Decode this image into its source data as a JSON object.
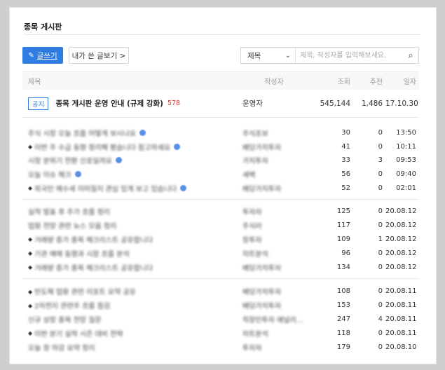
{
  "board": {
    "title": "종목 게시판"
  },
  "toolbar": {
    "write_label": "글쓰기",
    "my_posts_label": "내가 쓴 글보기 >",
    "search_type": "제목",
    "search_placeholder": "제목, 작성자를 입력해보세요."
  },
  "table": {
    "headers": {
      "title": "제목",
      "author": "작성자",
      "views": "조회",
      "likes": "추천",
      "date": "일자"
    },
    "notice": {
      "badge": "공지",
      "title": "종목 게시판 운영 안내 (규제 강화)",
      "comment_count": "578",
      "author": "운영자",
      "views": "545,144",
      "likes": "1,486",
      "date": "17.10.30"
    },
    "groups": [
      [
        {
          "title": "주식 시장 오늘 흐름 어떻게 보시나요",
          "bullet": false,
          "new": true,
          "author": "주식초보",
          "views": "30",
          "likes": "0",
          "date": "13:50"
        },
        {
          "title": "이번 주 수급 동향 정리해 봤습니다 참고하세요",
          "bullet": true,
          "new": true,
          "author": "배당가치투자",
          "views": "41",
          "likes": "0",
          "date": "10:11"
        },
        {
          "title": "시장 분위기 전환 신호일까요",
          "bullet": false,
          "new": true,
          "author": "가치투자",
          "views": "33",
          "likes": "3",
          "date": "09:53"
        },
        {
          "title": "오늘 이슈 체크",
          "bullet": false,
          "new": true,
          "author": "새벽",
          "views": "56",
          "likes": "0",
          "date": "09:40"
        },
        {
          "title": "외국인 매수세 이어질지 관심 있게 보고 있습니다",
          "bullet": true,
          "new": true,
          "author": "배당가치투자",
          "views": "52",
          "likes": "0",
          "date": "02:01"
        }
      ],
      [
        {
          "title": "실적 발표 후 주가 흐름 정리",
          "bullet": false,
          "new": false,
          "author": "투자자",
          "views": "125",
          "likes": "0",
          "date": "20.08.12"
        },
        {
          "title": "업황 전망 관련 뉴스 모음 정리",
          "bullet": false,
          "new": false,
          "author": "주식러",
          "views": "117",
          "likes": "0",
          "date": "20.08.12"
        },
        {
          "title": "거래량 증가 종목 체크리스트 공유합니다",
          "bullet": true,
          "new": false,
          "author": "장투자",
          "views": "109",
          "likes": "1",
          "date": "20.08.12"
        },
        {
          "title": "기관 매매 동향과 시장 흐름 분석",
          "bullet": true,
          "new": false,
          "author": "차트분석",
          "views": "96",
          "likes": "0",
          "date": "20.08.12"
        },
        {
          "title": "거래량 증가 종목 체크리스트 공유합니다",
          "bullet": true,
          "new": false,
          "author": "배당가치투자",
          "views": "134",
          "likes": "0",
          "date": "20.08.12"
        }
      ],
      [
        {
          "title": "반도체 업황 관련 리포트 요약 공유",
          "bullet": true,
          "new": false,
          "author": "배당가치투자",
          "views": "108",
          "likes": "0",
          "date": "20.08.11"
        },
        {
          "title": "2차전지 관련주 흐름 점검",
          "bullet": true,
          "new": false,
          "author": "배당가치투자",
          "views": "153",
          "likes": "0",
          "date": "20.08.11"
        },
        {
          "title": "신규 상장 종목 전망 질문",
          "bullet": false,
          "new": false,
          "author": "직장인투자 애널리...",
          "views": "247",
          "likes": "4",
          "date": "20.08.11"
        },
        {
          "title": "이번 분기 실적 시즌 대비 전략",
          "bullet": true,
          "new": false,
          "author": "차트분석",
          "views": "118",
          "likes": "0",
          "date": "20.08.11"
        },
        {
          "title": "오늘 장 마감 요약 정리",
          "bullet": false,
          "new": false,
          "author": "투자자",
          "views": "179",
          "likes": "0",
          "date": "20.08.10"
        }
      ]
    ]
  },
  "colors": {
    "accent": "#2f7de1",
    "alert": "#e03c31"
  },
  "icons": {
    "write": "pencil-icon",
    "dropdown": "chevron-down-icon",
    "search": "search-icon",
    "new_post": "new-post-dot-icon"
  }
}
